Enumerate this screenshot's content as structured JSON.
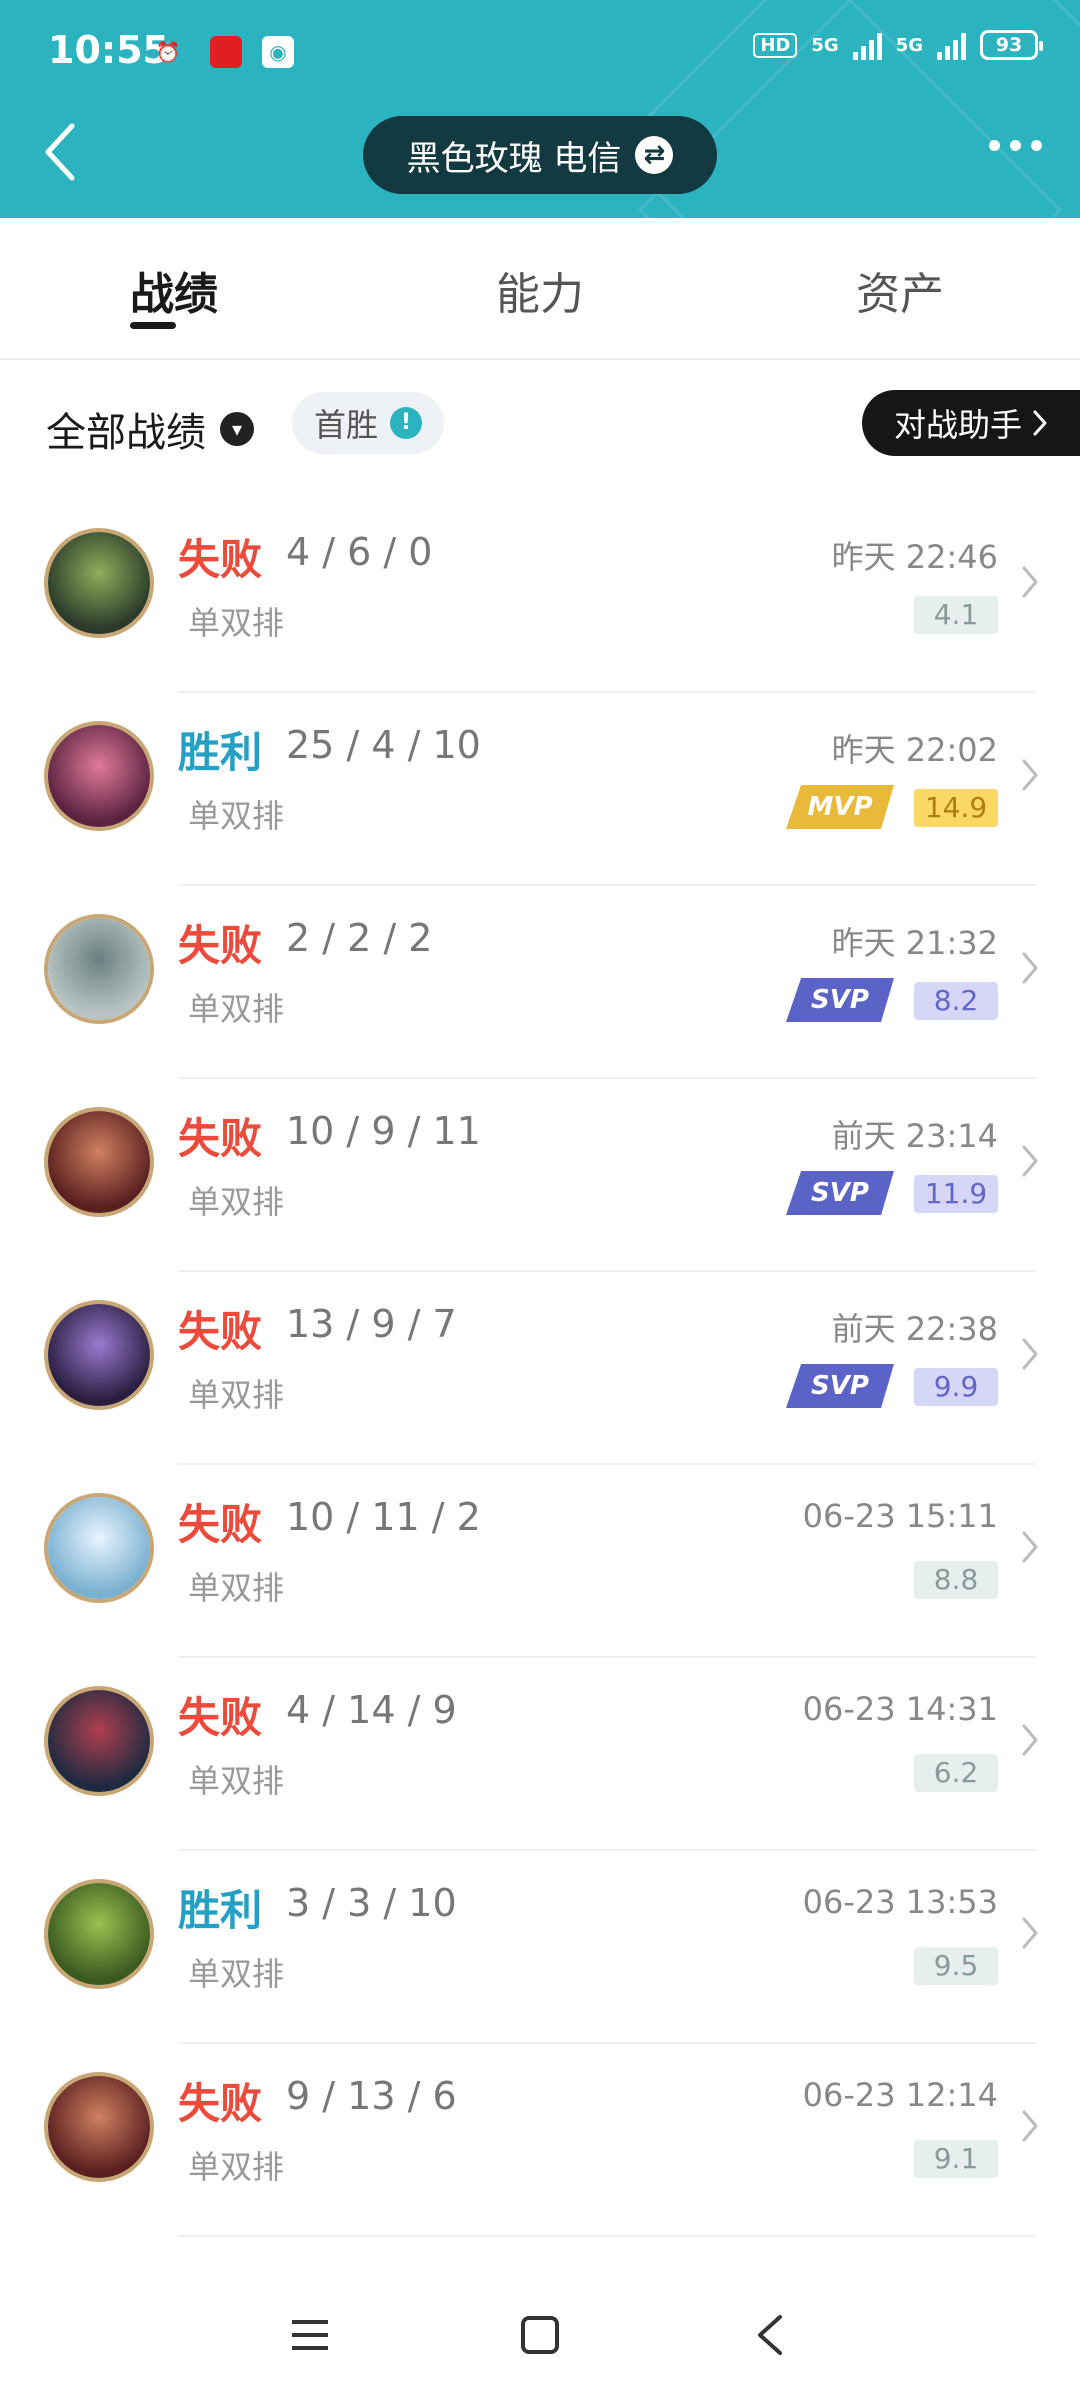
{
  "status_bar": {
    "time": "10:55",
    "hd": "HD",
    "net1": "5G",
    "net2": "5G",
    "battery": "93"
  },
  "header": {
    "account_name": "黑色玫瑰 电信",
    "swap_icon": "swap-icon",
    "back_icon": "chevron-left-icon",
    "more_icon": "more-dots-icon"
  },
  "tabs": [
    {
      "label": "战绩",
      "active": true
    },
    {
      "label": "能力",
      "active": false
    },
    {
      "label": "资产",
      "active": false
    }
  ],
  "filter": {
    "all_label": "全部战绩",
    "first_win_label": "首胜",
    "first_win_icon": "!",
    "helper_label": "对战助手"
  },
  "matches": [
    {
      "result": "失败",
      "kda": "4 / 6 / 0",
      "mode": "单双排",
      "time": "昨天 22:46",
      "score": "4.1",
      "badge": ""
    },
    {
      "result": "胜利",
      "kda": "25 / 4 / 10",
      "mode": "单双排",
      "time": "昨天 22:02",
      "score": "14.9",
      "badge": "MVP"
    },
    {
      "result": "失败",
      "kda": "2 / 2 / 2",
      "mode": "单双排",
      "time": "昨天 21:32",
      "score": "8.2",
      "badge": "SVP"
    },
    {
      "result": "失败",
      "kda": "10 / 9 / 11",
      "mode": "单双排",
      "time": "前天 23:14",
      "score": "11.9",
      "badge": "SVP"
    },
    {
      "result": "失败",
      "kda": "13 / 9 / 7",
      "mode": "单双排",
      "time": "前天 22:38",
      "score": "9.9",
      "badge": "SVP"
    },
    {
      "result": "失败",
      "kda": "10 / 11 / 2",
      "mode": "单双排",
      "time": "06-23 15:11",
      "score": "8.8",
      "badge": ""
    },
    {
      "result": "失败",
      "kda": "4 / 14 / 9",
      "mode": "单双排",
      "time": "06-23 14:31",
      "score": "6.2",
      "badge": ""
    },
    {
      "result": "胜利",
      "kda": "3 / 3 / 10",
      "mode": "单双排",
      "time": "06-23 13:53",
      "score": "9.5",
      "badge": ""
    },
    {
      "result": "失败",
      "kda": "9 / 13 / 6",
      "mode": "单双排",
      "time": "06-23 12:14",
      "score": "9.1",
      "badge": ""
    }
  ],
  "colors": {
    "header_bg": "#2cb3c0",
    "lose": "#ec4a3a",
    "win": "#24a0c5",
    "mvp": "#e9b93a",
    "svp": "#5c63c7"
  },
  "nav": {
    "menu_icon": "menu-icon",
    "home_icon": "home-square-icon",
    "back_icon": "back-triangle-icon"
  }
}
